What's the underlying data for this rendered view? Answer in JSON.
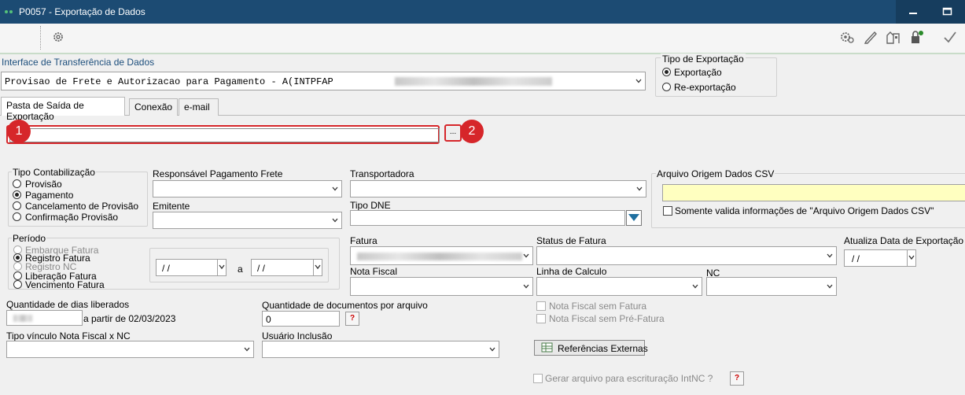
{
  "window": {
    "title": "P0057 - Exportação de Dados"
  },
  "interface": {
    "label": "Interface de Transferência de Dados",
    "value": "Provisao de Frete e Autorizacao para Pagamento - A(INTPFAP"
  },
  "tipo_exportacao": {
    "legend": "Tipo de Exportação",
    "options": [
      "Exportação",
      "Re-exportação"
    ],
    "selected": "Exportação"
  },
  "tabs": [
    "Pasta de Saída de Exportação",
    "Conexão",
    "e-mail"
  ],
  "active_tab": "Pasta de Saída de Exportação",
  "markers": [
    "1",
    "2"
  ],
  "browse_button_label": "...",
  "tipo_contabilizacao": {
    "legend": "Tipo Contabilização",
    "options": [
      "Provisão",
      "Pagamento",
      "Cancelamento de Provisão",
      "Confirmação Provisão"
    ],
    "selected": "Pagamento"
  },
  "responsavel": {
    "label": "Responsável Pagamento Frete",
    "value": ""
  },
  "emitente": {
    "label": "Emitente",
    "value": ""
  },
  "transportadora": {
    "label": "Transportadora",
    "value": ""
  },
  "tipo_dne": {
    "label": "Tipo DNE",
    "value": ""
  },
  "arquivo_csv": {
    "legend": "Arquivo Origem Dados CSV",
    "value": "",
    "checkbox_label": "Somente valida informações de \"Arquivo Origem Dados CSV\"",
    "checked": false
  },
  "periodo": {
    "legend": "Período",
    "options": [
      "Embarque Fatura",
      "Registro Fatura",
      "Registro NC",
      "Liberação Fatura",
      "Vencimento Fatura"
    ],
    "disabled": [
      "Embarque Fatura",
      "Registro NC"
    ],
    "selected": "Registro Fatura",
    "date_from": "/ /",
    "connector": "a",
    "date_to": "/ /"
  },
  "fatura": {
    "label": "Fatura",
    "value": ""
  },
  "status_fatura": {
    "label": "Status de Fatura",
    "value": ""
  },
  "atualiza_data": {
    "label": "Atualiza Data de Exportação com",
    "value": "/ /"
  },
  "nota_fiscal": {
    "label": "Nota Fiscal",
    "value": ""
  },
  "linha_calculo": {
    "label": "Linha de Calculo",
    "value": ""
  },
  "nc": {
    "label": "NC",
    "value": ""
  },
  "qtd_dias": {
    "label": "Quantidade de dias liberados",
    "value": "",
    "suffix": "a partir de 02/03/2023"
  },
  "qtd_docs": {
    "label": "Quantidade de documentos por arquivo",
    "value": "0"
  },
  "help_label": "?",
  "nf_sem_fatura": {
    "label": "Nota Fiscal sem Fatura",
    "checked": false
  },
  "nf_sem_prefatura": {
    "label": "Nota Fiscal sem Pré-Fatura",
    "checked": false
  },
  "tipo_vinculo": {
    "label": "Tipo vínculo Nota Fiscal x NC",
    "value": ""
  },
  "usuario_inclusao": {
    "label": "Usuário Inclusão",
    "value": ""
  },
  "referencias_externas": {
    "label": "Referências Externas"
  },
  "gerar_arquivo": {
    "label": "Gerar arquivo para escrituração IntNC ?",
    "checked": false
  },
  "icons": [
    "gear-icon",
    "settings-gear-icon",
    "pen-icon",
    "building-icon",
    "lock-key-icon",
    "check-icon",
    "minimize-icon",
    "maximize-icon",
    "chevron-down-icon"
  ],
  "colors": {
    "titlebar": "#1c4b73",
    "marker": "#d6262a",
    "csv_field": "#ffffc0",
    "label_blue": "#1c4e7c"
  }
}
